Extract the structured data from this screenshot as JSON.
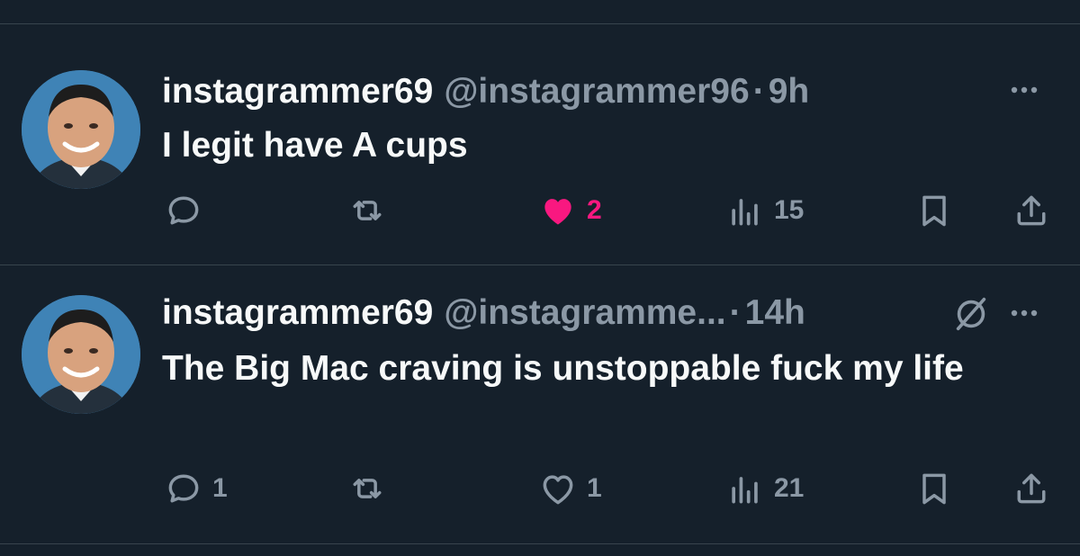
{
  "colors": {
    "background": "#15202b",
    "divider": "#38444d",
    "primary_text": "#f7f9f9",
    "secondary_text": "#8b98a5",
    "like_active": "#f91880",
    "avatar_bg": "#3f83b6"
  },
  "tweets": [
    {
      "display_name": "instagrammer69",
      "handle": "@instagrammer96",
      "separator": "·",
      "time": "9h",
      "text": "I legit have A cups",
      "more_icon": "more-icon",
      "actions": {
        "reply": {
          "icon": "reply-icon",
          "count": ""
        },
        "retweet": {
          "icon": "retweet-icon",
          "count": ""
        },
        "like": {
          "icon": "heart-filled-icon",
          "count": "2",
          "liked": true
        },
        "views": {
          "icon": "views-icon",
          "count": "15"
        },
        "bookmark": {
          "icon": "bookmark-icon"
        },
        "share": {
          "icon": "share-icon"
        }
      }
    },
    {
      "display_name": "instagrammer69",
      "handle": "@instagramme...",
      "separator": "·",
      "time": "14h",
      "text": "The Big Mac craving is unstoppable fuck my life",
      "more_icon": "more-icon",
      "grok_icon": "grok-icon",
      "actions": {
        "reply": {
          "icon": "reply-icon",
          "count": "1"
        },
        "retweet": {
          "icon": "retweet-icon",
          "count": ""
        },
        "like": {
          "icon": "heart-outline-icon",
          "count": "1",
          "liked": false
        },
        "views": {
          "icon": "views-icon",
          "count": "21"
        },
        "bookmark": {
          "icon": "bookmark-icon"
        },
        "share": {
          "icon": "share-icon"
        }
      }
    }
  ]
}
